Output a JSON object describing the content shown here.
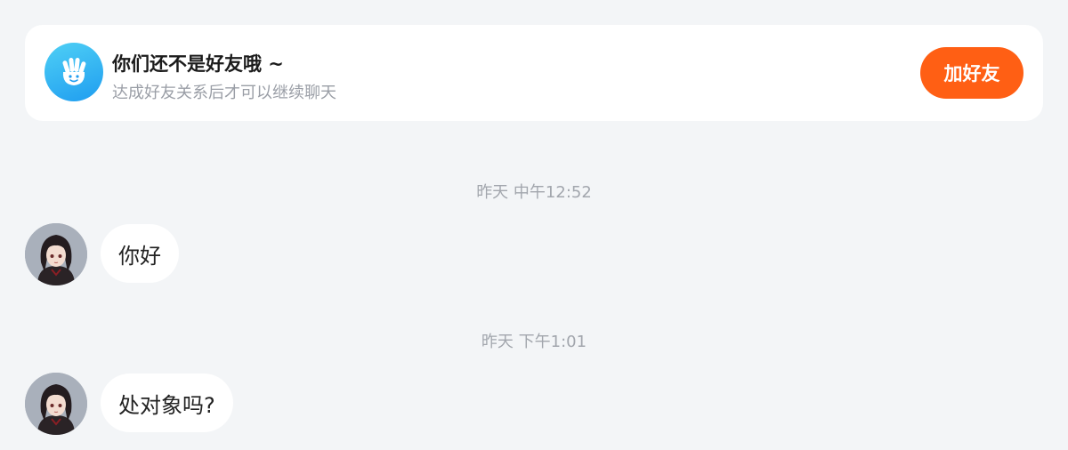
{
  "banner": {
    "icon": "hand-wave-icon",
    "title": "你们还不是好友哦 ~",
    "subtitle": "达成好友关系后才可以继续聊天",
    "add_button_label": "加好友"
  },
  "messages": [
    {
      "timestamp": "昨天 中午12:52",
      "text": "你好",
      "avatar": "user-avatar"
    },
    {
      "timestamp": "昨天 下午1:01",
      "text": "处对象吗?",
      "avatar": "user-avatar"
    }
  ],
  "colors": {
    "accent": "#ff5f14",
    "icon_blue": "#1f9df0",
    "background": "#f3f5f7"
  }
}
